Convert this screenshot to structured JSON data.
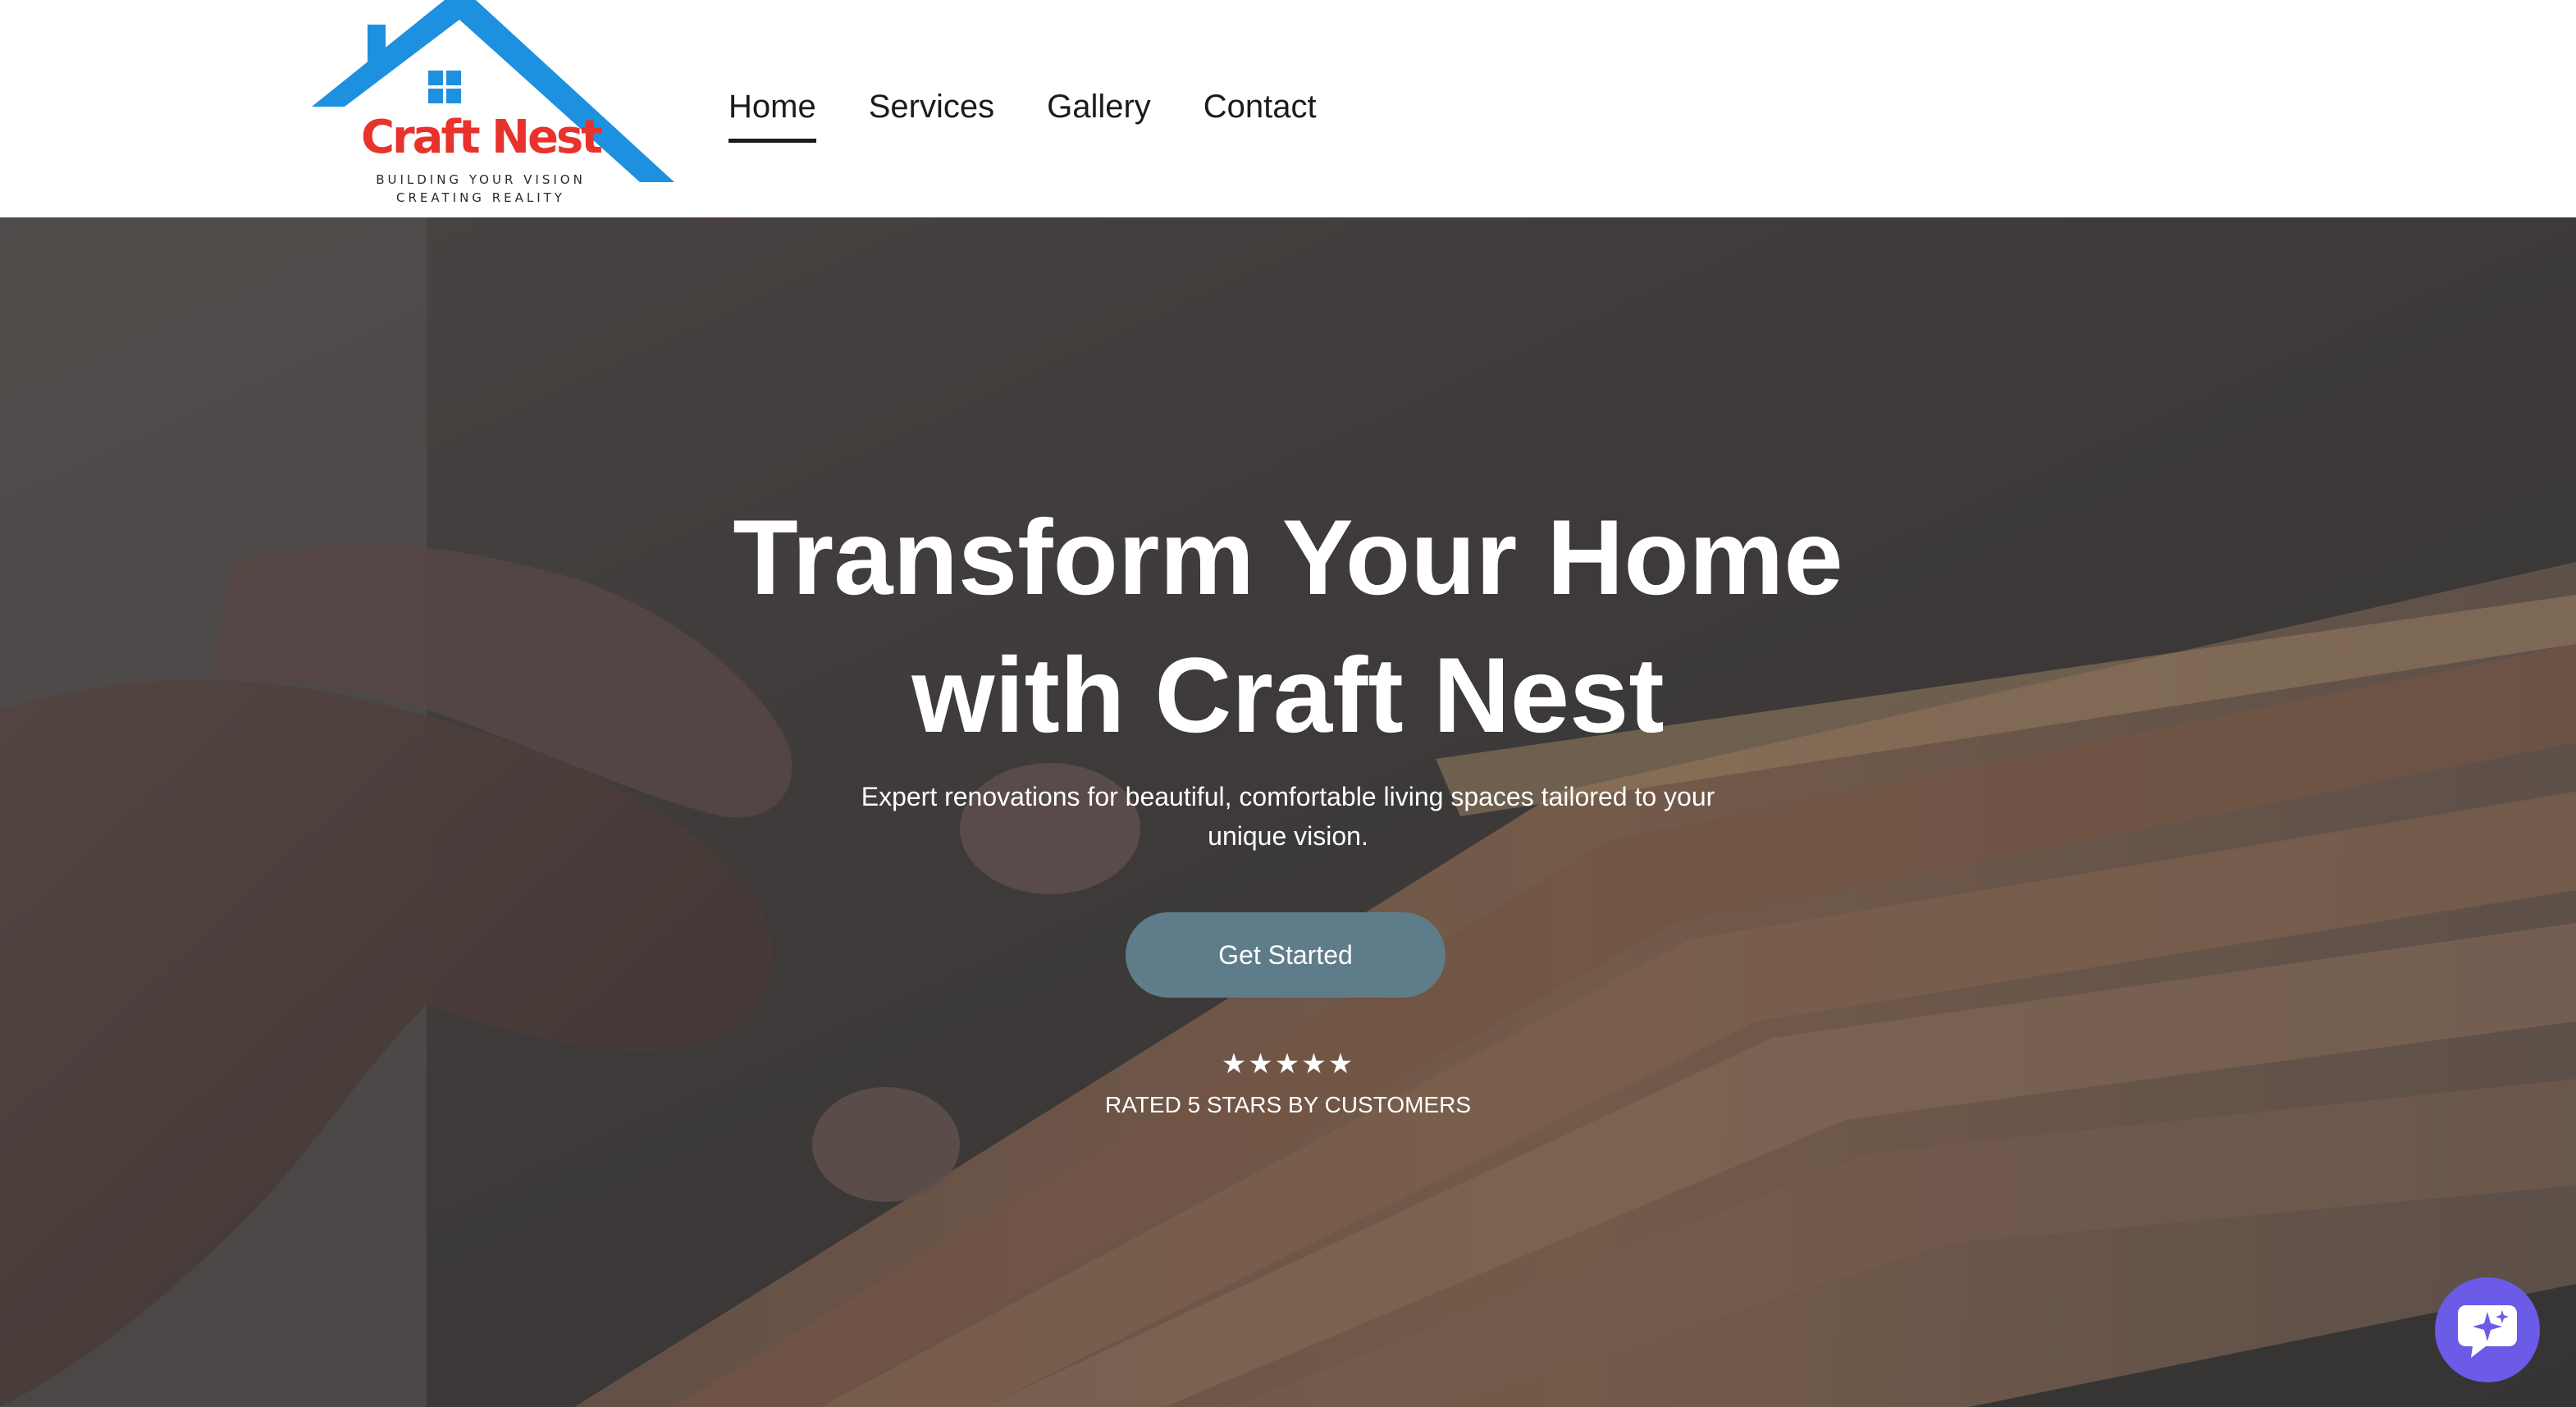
{
  "brand": {
    "name": "Craft Nest",
    "tagline_line1": "BUILDING YOUR VISION",
    "tagline_line2": "CREATING REALITY",
    "roof_color": "#1e90e0",
    "name_color": "#e8332c"
  },
  "nav": {
    "items": [
      {
        "label": "Home",
        "active": true
      },
      {
        "label": "Services",
        "active": false
      },
      {
        "label": "Gallery",
        "active": false
      },
      {
        "label": "Contact",
        "active": false
      }
    ]
  },
  "hero": {
    "title_line1": "Transform Your Home",
    "title_line2": "with Craft Nest",
    "subtitle": "Expert renovations for beautiful, comfortable living spaces tailored to your unique vision.",
    "cta_label": "Get Started",
    "cta_color": "#5f7c8a",
    "stars": "★★★★★",
    "rating_text": "RATED 5 STARS BY CUSTOMERS"
  },
  "chat_widget": {
    "icon": "chat-sparkle-icon",
    "color": "#6b5be6"
  }
}
